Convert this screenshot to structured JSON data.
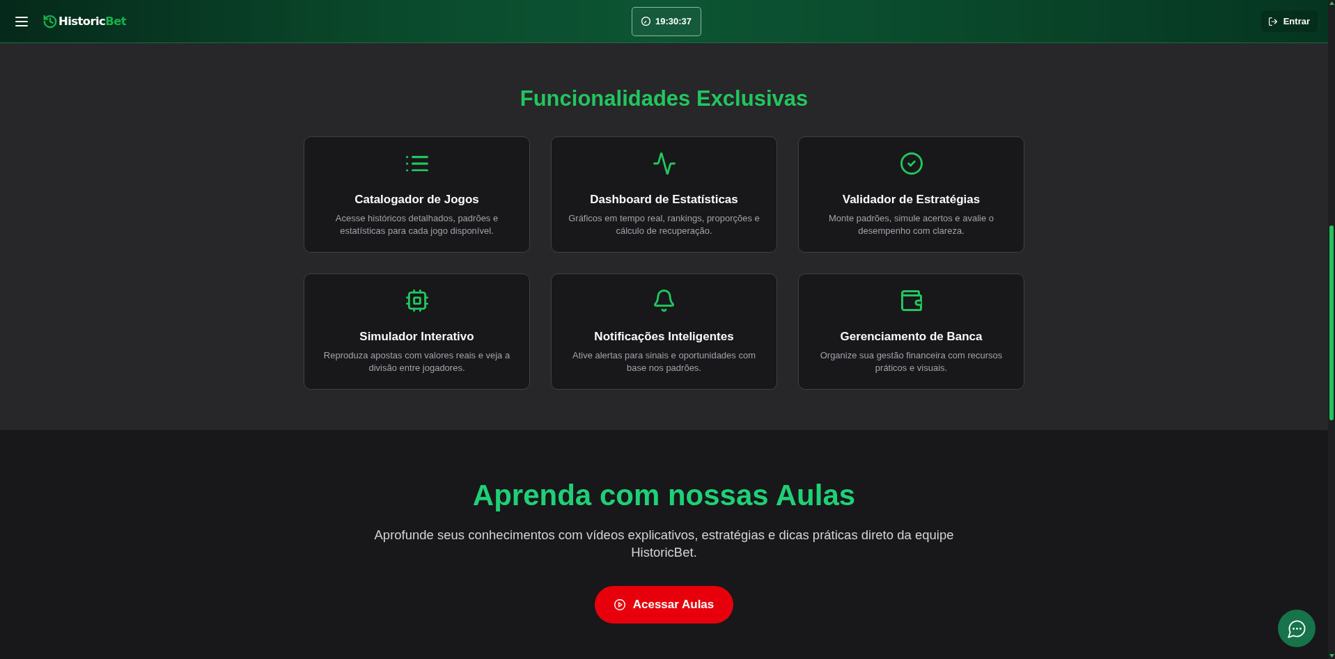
{
  "header": {
    "logo": {
      "primary": "Historic",
      "accent": "Bet"
    },
    "clock": "19:30:37",
    "login_button": "Entrar"
  },
  "features": {
    "title": "Funcionalidades Exclusivas",
    "cards": [
      {
        "title": "Catalogador de Jogos",
        "description": "Acesse históricos detalhados, padrões e estatísticas para cada jogo disponível."
      },
      {
        "title": "Dashboard de Estatísticas",
        "description": "Gráficos em tempo real, rankings, proporções e cálculo de recuperação."
      },
      {
        "title": "Validador de Estratégias",
        "description": "Monte padrões, simule acertos e avalie o desempenho com clareza."
      },
      {
        "title": "Simulador Interativo",
        "description": "Reproduza apostas com valores reais e veja a divisão entre jogadores."
      },
      {
        "title": "Notificações Inteligentes",
        "description": "Ative alertas para sinais e oportunidades com base nos padrões."
      },
      {
        "title": "Gerenciamento de Banca",
        "description": "Organize sua gestão financeira com recursos práticos e visuais."
      }
    ]
  },
  "lessons": {
    "title": "Aprenda com nossas Aulas",
    "description": "Aprofunde seus conhecimentos com vídeos explicativos, estratégias e dicas práticas direto da equipe HistoricBet.",
    "button": "Acessar Aulas"
  }
}
